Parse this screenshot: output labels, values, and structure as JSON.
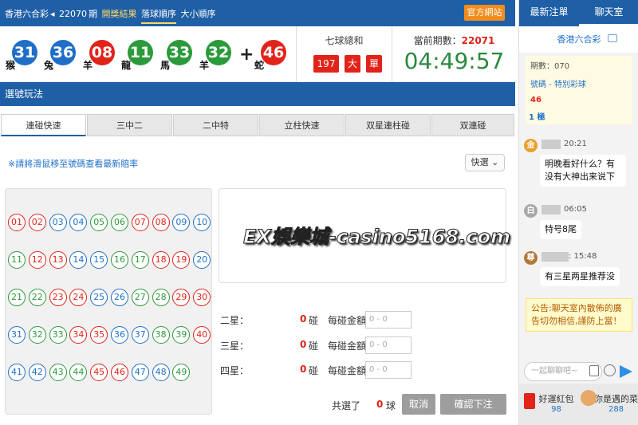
{
  "topbar": {
    "lottery": "香港六合彩",
    "period_prefix": "22070",
    "period_suffix": "期",
    "link_results": "開獎結果",
    "link_fall_order": "落球順序",
    "link_size_order": "大小順序",
    "official_site": "官方網站"
  },
  "draw": {
    "balls": [
      {
        "num": "31",
        "zodiac": "猴",
        "color": "blue"
      },
      {
        "num": "36",
        "zodiac": "兔",
        "color": "blue"
      },
      {
        "num": "08",
        "zodiac": "羊",
        "color": "red"
      },
      {
        "num": "11",
        "zodiac": "龍",
        "color": "green"
      },
      {
        "num": "33",
        "zodiac": "馬",
        "color": "green"
      },
      {
        "num": "32",
        "zodiac": "羊",
        "color": "green"
      }
    ],
    "plus": "+",
    "special": {
      "num": "46",
      "zodiac": "蛇",
      "color": "red"
    },
    "sum_label": "七球總和",
    "sum_value": "197",
    "sum_size": "大",
    "sum_parity": "單",
    "period_label": "當前期數：",
    "period_value": "22071",
    "countdown": "04:49:57"
  },
  "selection": {
    "title": "選號玩法"
  },
  "tabs": [
    "連碰快速",
    "三中二",
    "二中特",
    "立柱快速",
    "双星連柱碰",
    "双連碰"
  ],
  "hint": "※請將滑鼠移至號碼查看最新賠率",
  "quick_select": "快選",
  "numbers": [
    {
      "n": "01",
      "c": "red"
    },
    {
      "n": "02",
      "c": "red"
    },
    {
      "n": "03",
      "c": "blue"
    },
    {
      "n": "04",
      "c": "blue"
    },
    {
      "n": "05",
      "c": "green"
    },
    {
      "n": "06",
      "c": "green"
    },
    {
      "n": "07",
      "c": "red"
    },
    {
      "n": "08",
      "c": "red"
    },
    {
      "n": "09",
      "c": "blue"
    },
    {
      "n": "10",
      "c": "blue"
    },
    {
      "n": "11",
      "c": "green"
    },
    {
      "n": "12",
      "c": "red"
    },
    {
      "n": "13",
      "c": "red"
    },
    {
      "n": "14",
      "c": "blue"
    },
    {
      "n": "15",
      "c": "blue"
    },
    {
      "n": "16",
      "c": "green"
    },
    {
      "n": "17",
      "c": "green"
    },
    {
      "n": "18",
      "c": "red"
    },
    {
      "n": "19",
      "c": "red"
    },
    {
      "n": "20",
      "c": "blue"
    },
    {
      "n": "21",
      "c": "green"
    },
    {
      "n": "22",
      "c": "green"
    },
    {
      "n": "23",
      "c": "red"
    },
    {
      "n": "24",
      "c": "red"
    },
    {
      "n": "25",
      "c": "blue"
    },
    {
      "n": "26",
      "c": "blue"
    },
    {
      "n": "27",
      "c": "green"
    },
    {
      "n": "28",
      "c": "green"
    },
    {
      "n": "29",
      "c": "red"
    },
    {
      "n": "30",
      "c": "red"
    },
    {
      "n": "31",
      "c": "blue"
    },
    {
      "n": "32",
      "c": "green"
    },
    {
      "n": "33",
      "c": "green"
    },
    {
      "n": "34",
      "c": "red"
    },
    {
      "n": "35",
      "c": "red"
    },
    {
      "n": "36",
      "c": "blue"
    },
    {
      "n": "37",
      "c": "blue"
    },
    {
      "n": "38",
      "c": "green"
    },
    {
      "n": "39",
      "c": "green"
    },
    {
      "n": "40",
      "c": "red"
    },
    {
      "n": "41",
      "c": "blue"
    },
    {
      "n": "42",
      "c": "blue"
    },
    {
      "n": "43",
      "c": "green"
    },
    {
      "n": "44",
      "c": "green"
    },
    {
      "n": "45",
      "c": "red"
    },
    {
      "n": "46",
      "c": "red"
    },
    {
      "n": "47",
      "c": "blue"
    },
    {
      "n": "48",
      "c": "blue"
    },
    {
      "n": "49",
      "c": "green"
    }
  ],
  "watermark": "EX娛樂城-casino5168.com",
  "bets": [
    {
      "label": "二星：",
      "count": "0",
      "prize_label": "碰　每碰金額：",
      "placeholder": "0 - 0"
    },
    {
      "label": "三星：",
      "count": "0",
      "prize_label": "碰　每碰金額：",
      "placeholder": "0 - 0"
    },
    {
      "label": "四星：",
      "count": "0",
      "prize_label": "碰　每碰金額：",
      "placeholder": "0 - 0"
    }
  ],
  "total": {
    "label": "共選了",
    "count": "0",
    "unit": "球"
  },
  "buttons": {
    "cancel": "取消",
    "confirm": "確認下注"
  },
  "sidebar": {
    "tab_latest": "最新注單",
    "tab_chat": "聊天室",
    "lottery_name": "香港六合彩",
    "card": {
      "period": "期數：070",
      "number_label": "號碼 - 特別彩球",
      "number": "46",
      "bet": "1 極"
    },
    "messages": [
      {
        "avatar": "金",
        "avatar_color": "#e8a02c",
        "time": "20:21",
        "text": "明晚看好什么？有没有大神出来说下"
      },
      {
        "avatar": "白",
        "avatar_color": "#a8a8a8",
        "time": "06:05",
        "text": "特号8尾"
      },
      {
        "avatar": "尊",
        "avatar_color": "#b07a3a",
        "time": ": 15:48",
        "text": "有三星两星推荐没"
      }
    ],
    "notice": "公告:聊天室內散佈的廣告切勿相信,謹防上當！",
    "input_placeholder": "一起聊聊吧~",
    "promo1": {
      "title": "好運紅包",
      "count": "98"
    },
    "promo2": {
      "title": "你是遇的菜",
      "count": "288"
    }
  }
}
